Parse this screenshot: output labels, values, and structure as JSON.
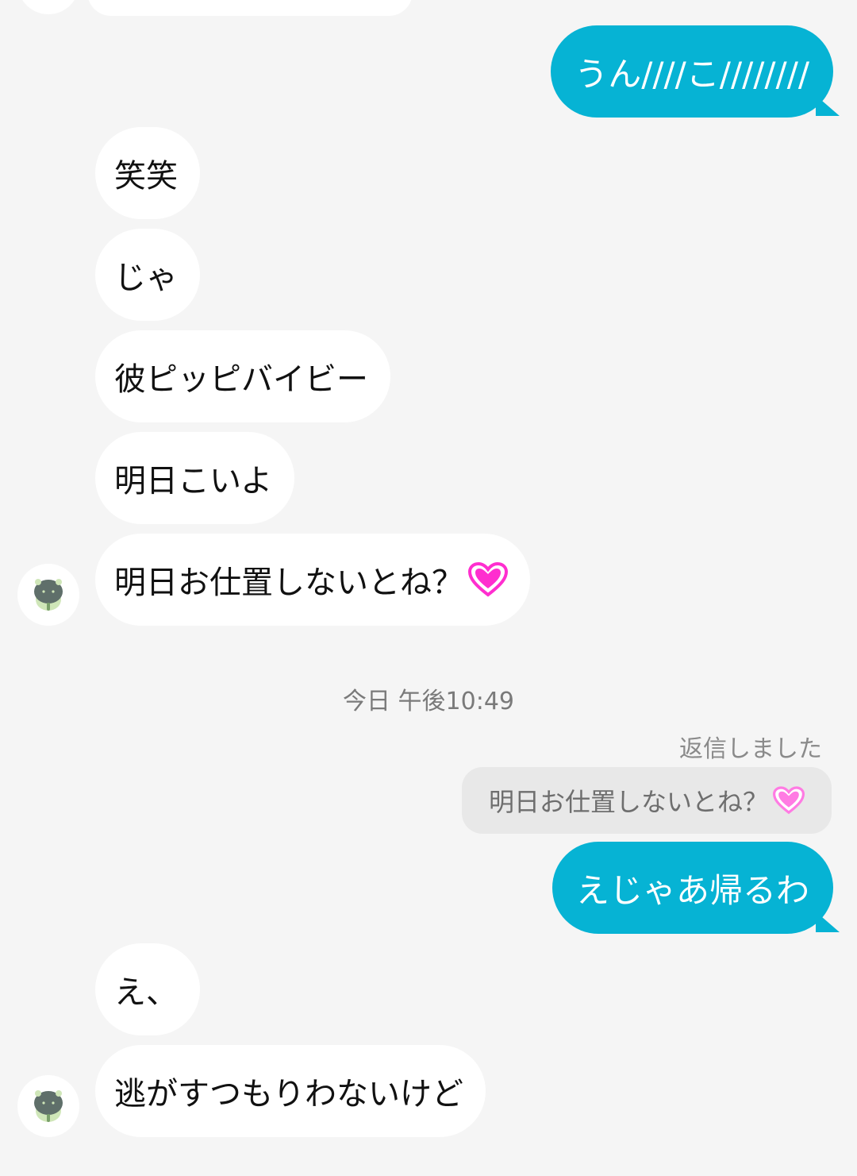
{
  "messages": [
    {
      "side": "out",
      "text": "うん////こ////////"
    },
    {
      "side": "in",
      "text": "笑笑"
    },
    {
      "side": "in",
      "text": "じゃ"
    },
    {
      "side": "in",
      "text": "彼ピッピバイビー"
    },
    {
      "side": "in",
      "text": "明日こいよ"
    },
    {
      "side": "in",
      "text": "明日お仕置しないとね？",
      "icon": "heart-icon"
    }
  ],
  "timestamp": "今日 午後10:49",
  "reply": {
    "label": "返信しました",
    "quoted_text": "明日お仕置しないとね？",
    "quoted_icon": "heart-icon",
    "text": "えじゃあ帰るわ"
  },
  "messages_after": [
    {
      "side": "in",
      "text": "え、"
    },
    {
      "side": "in",
      "text": "逃がすつもりわないけど"
    }
  ],
  "colors": {
    "background": "#f5f5f5",
    "incoming_bubble": "#ffffff",
    "outgoing_bubble": "#06b3d4",
    "heart": "#ff2ecf",
    "quote_bubble": "#e8e8e8"
  }
}
